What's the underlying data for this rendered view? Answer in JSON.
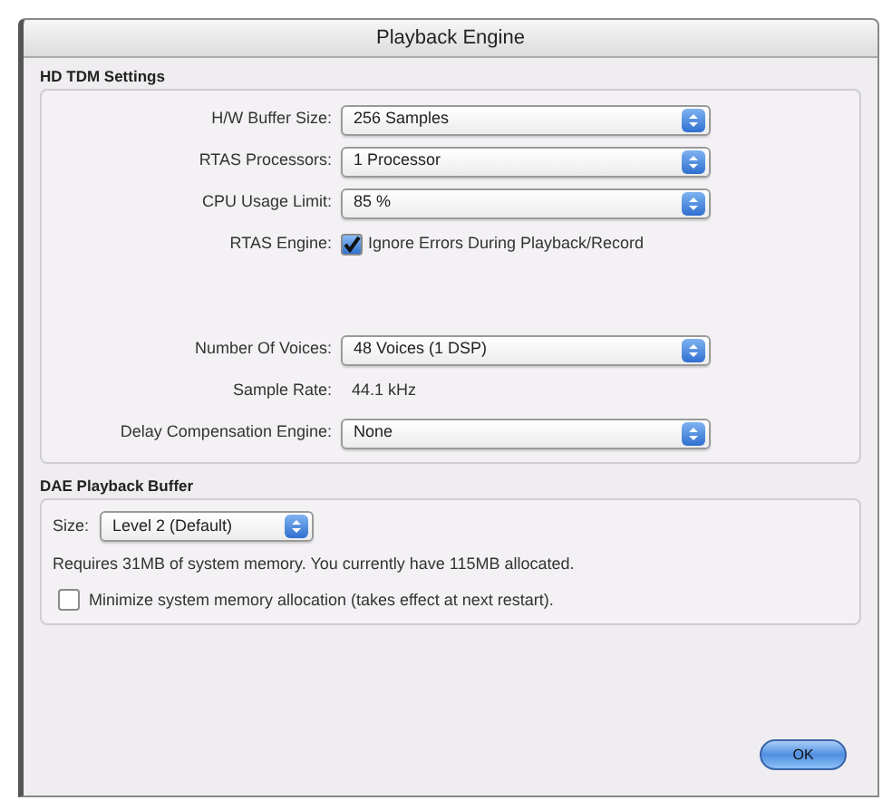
{
  "window": {
    "title": "Playback Engine"
  },
  "hd_tdm_settings": {
    "title": "HD TDM Settings",
    "rows": [
      {
        "kind": "select",
        "label": "H/W Buffer Size:",
        "value": "256 Samples"
      },
      {
        "kind": "select",
        "label": "RTAS Processors:",
        "value": "1 Processor"
      },
      {
        "kind": "select",
        "label": "CPU Usage Limit:",
        "value": "85 %"
      },
      {
        "kind": "checkbox",
        "label": "RTAS Engine:",
        "value": "Ignore Errors During Playback/Record",
        "checked": true
      },
      {
        "kind": "spacer"
      },
      {
        "kind": "select",
        "label": "Number Of Voices:",
        "value": "48 Voices (1 DSP)"
      },
      {
        "kind": "text",
        "label": "Sample Rate:",
        "value": "44.1 kHz"
      },
      {
        "kind": "select",
        "label": "Delay Compensation Engine:",
        "value": "None"
      }
    ]
  },
  "dae_playback_buffer": {
    "title": "DAE Playback Buffer",
    "size_label": "Size:",
    "size_value": "Level 2 (Default)",
    "info": "Requires 31MB of system memory. You currently have 115MB allocated.",
    "minimize": {
      "label": "Minimize system memory allocation (takes effect at next restart).",
      "checked": false
    }
  },
  "buttons": [
    {
      "label": "OK"
    }
  ]
}
